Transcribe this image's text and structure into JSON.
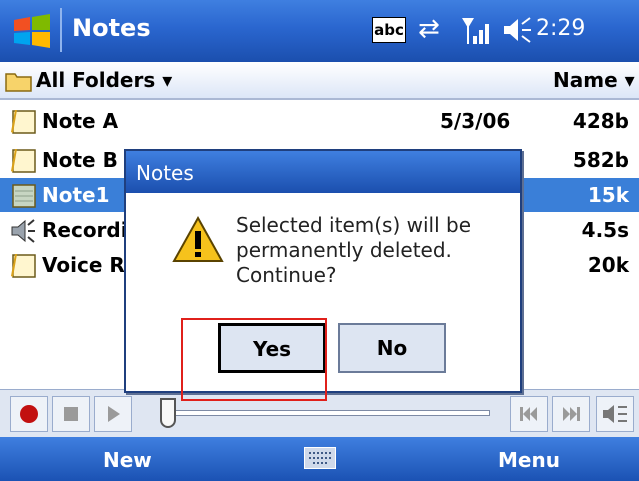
{
  "titlebar": {
    "app_title": "Notes",
    "input_indicator": "abc",
    "clock": "2:29",
    "start_icon": "windows-flag-icon"
  },
  "folder_bar": {
    "folder": "All Folders ▾",
    "sort": "Name ▾"
  },
  "list": [
    {
      "name": "Note A",
      "date": "5/3/06",
      "size": "428b",
      "icon": "note-icon",
      "selected": false
    },
    {
      "name": "Note B",
      "date": "",
      "size": "582b",
      "icon": "note-icon",
      "selected": false
    },
    {
      "name": "Note1",
      "date": "",
      "size": "15k",
      "icon": "note-icon",
      "selected": true
    },
    {
      "name": "Recordi",
      "date": "",
      "size": "4.5s",
      "icon": "speaker-icon",
      "selected": false
    },
    {
      "name": "Voice Re",
      "date": "",
      "size": "20k",
      "icon": "note-icon",
      "selected": false
    }
  ],
  "menubar": {
    "left": "New",
    "right": "Menu"
  },
  "dialog": {
    "title": "Notes",
    "message": "Selected item(s) will be permanently deleted. Continue?",
    "yes": "Yes",
    "no": "No"
  },
  "colors": {
    "accent": "#2a66cf",
    "selection": "#3a7fd8",
    "highlight": "#e0201b"
  }
}
